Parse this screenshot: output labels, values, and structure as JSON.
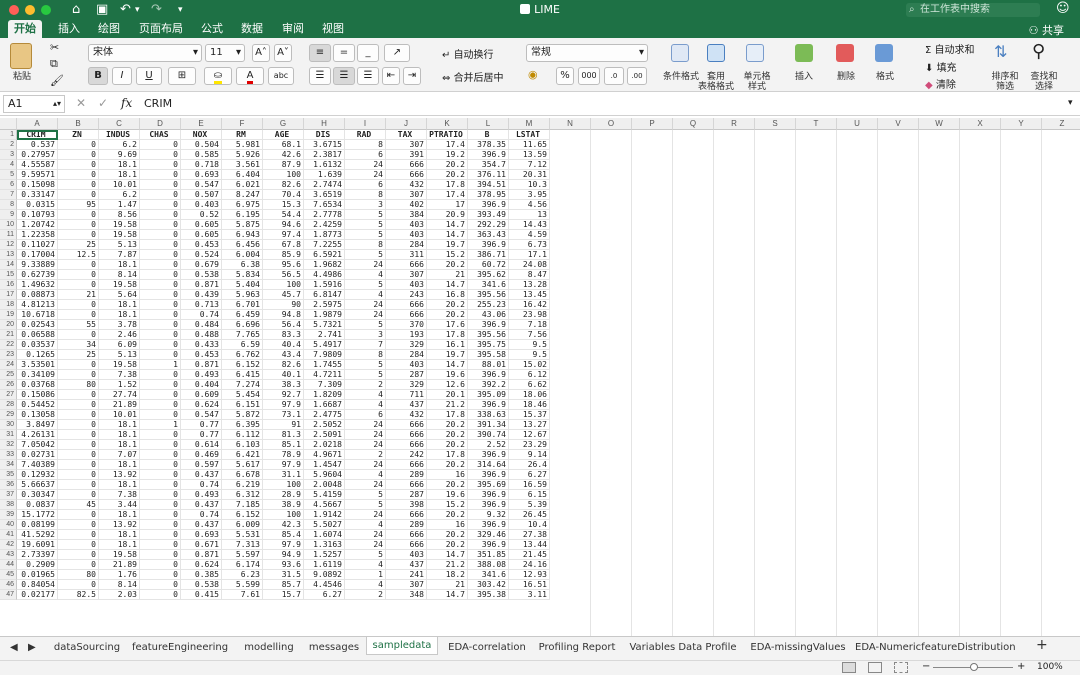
{
  "window": {
    "title": "LIME"
  },
  "search": {
    "placeholder": "在工作表中搜索"
  },
  "ribbon_tabs": [
    "开始",
    "插入",
    "绘图",
    "页面布局",
    "公式",
    "数据",
    "审阅",
    "视图"
  ],
  "share": {
    "label": "共享"
  },
  "home": {
    "paste": "粘贴",
    "font_name": "宋体",
    "font_size": "11",
    "wrap_text": "自动换行",
    "merge_center": "合并后居中",
    "number_format": "常规",
    "cond_format": "条件格式",
    "table_format": [
      "套用",
      "表格格式"
    ],
    "cell_style": [
      "单元格",
      "样式"
    ],
    "insert": "插入",
    "delete": "删除",
    "format": "格式",
    "autosum": "自动求和",
    "fill": "填充",
    "clear": "清除",
    "sort_filter": [
      "排序和",
      "筛选"
    ],
    "find_select": [
      "查找和",
      "选择"
    ]
  },
  "formula_bar": {
    "cell_ref": "A1",
    "fx": "fx",
    "content": "CRIM"
  },
  "columns": [
    "A",
    "B",
    "C",
    "D",
    "E",
    "F",
    "G",
    "H",
    "I",
    "J",
    "K",
    "L",
    "M",
    "N",
    "O",
    "P",
    "Q",
    "R",
    "S",
    "T",
    "U",
    "V",
    "W",
    "X",
    "Y",
    "Z"
  ],
  "table": {
    "headers": [
      "CRIM",
      "ZN",
      "INDUS",
      "CHAS",
      "NOX",
      "RM",
      "AGE",
      "DIS",
      "RAD",
      "TAX",
      "PTRATIO",
      "B",
      "LSTAT"
    ],
    "rows": [
      [
        "0.537",
        "0",
        "6.2",
        "0",
        "0.504",
        "5.981",
        "68.1",
        "3.6715",
        "8",
        "307",
        "17.4",
        "378.35",
        "11.65"
      ],
      [
        "0.27957",
        "0",
        "9.69",
        "0",
        "0.585",
        "5.926",
        "42.6",
        "2.3817",
        "6",
        "391",
        "19.2",
        "396.9",
        "13.59"
      ],
      [
        "4.55587",
        "0",
        "18.1",
        "0",
        "0.718",
        "3.561",
        "87.9",
        "1.6132",
        "24",
        "666",
        "20.2",
        "354.7",
        "7.12"
      ],
      [
        "9.59571",
        "0",
        "18.1",
        "0",
        "0.693",
        "6.404",
        "100",
        "1.639",
        "24",
        "666",
        "20.2",
        "376.11",
        "20.31"
      ],
      [
        "0.15098",
        "0",
        "10.01",
        "0",
        "0.547",
        "6.021",
        "82.6",
        "2.7474",
        "6",
        "432",
        "17.8",
        "394.51",
        "10.3"
      ],
      [
        "0.33147",
        "0",
        "6.2",
        "0",
        "0.507",
        "8.247",
        "70.4",
        "3.6519",
        "8",
        "307",
        "17.4",
        "378.95",
        "3.95"
      ],
      [
        "0.0315",
        "95",
        "1.47",
        "0",
        "0.403",
        "6.975",
        "15.3",
        "7.6534",
        "3",
        "402",
        "17",
        "396.9",
        "4.56"
      ],
      [
        "0.10793",
        "0",
        "8.56",
        "0",
        "0.52",
        "6.195",
        "54.4",
        "2.7778",
        "5",
        "384",
        "20.9",
        "393.49",
        "13"
      ],
      [
        "1.20742",
        "0",
        "19.58",
        "0",
        "0.605",
        "5.875",
        "94.6",
        "2.4259",
        "5",
        "403",
        "14.7",
        "292.29",
        "14.43"
      ],
      [
        "1.22358",
        "0",
        "19.58",
        "0",
        "0.605",
        "6.943",
        "97.4",
        "1.8773",
        "5",
        "403",
        "14.7",
        "363.43",
        "4.59"
      ],
      [
        "0.11027",
        "25",
        "5.13",
        "0",
        "0.453",
        "6.456",
        "67.8",
        "7.2255",
        "8",
        "284",
        "19.7",
        "396.9",
        "6.73"
      ],
      [
        "0.17004",
        "12.5",
        "7.87",
        "0",
        "0.524",
        "6.004",
        "85.9",
        "6.5921",
        "5",
        "311",
        "15.2",
        "386.71",
        "17.1"
      ],
      [
        "9.33889",
        "0",
        "18.1",
        "0",
        "0.679",
        "6.38",
        "95.6",
        "1.9682",
        "24",
        "666",
        "20.2",
        "60.72",
        "24.08"
      ],
      [
        "0.62739",
        "0",
        "8.14",
        "0",
        "0.538",
        "5.834",
        "56.5",
        "4.4986",
        "4",
        "307",
        "21",
        "395.62",
        "8.47"
      ],
      [
        "1.49632",
        "0",
        "19.58",
        "0",
        "0.871",
        "5.404",
        "100",
        "1.5916",
        "5",
        "403",
        "14.7",
        "341.6",
        "13.28"
      ],
      [
        "0.08873",
        "21",
        "5.64",
        "0",
        "0.439",
        "5.963",
        "45.7",
        "6.8147",
        "4",
        "243",
        "16.8",
        "395.56",
        "13.45"
      ],
      [
        "4.81213",
        "0",
        "18.1",
        "0",
        "0.713",
        "6.701",
        "90",
        "2.5975",
        "24",
        "666",
        "20.2",
        "255.23",
        "16.42"
      ],
      [
        "10.6718",
        "0",
        "18.1",
        "0",
        "0.74",
        "6.459",
        "94.8",
        "1.9879",
        "24",
        "666",
        "20.2",
        "43.06",
        "23.98"
      ],
      [
        "0.02543",
        "55",
        "3.78",
        "0",
        "0.484",
        "6.696",
        "56.4",
        "5.7321",
        "5",
        "370",
        "17.6",
        "396.9",
        "7.18"
      ],
      [
        "0.06588",
        "0",
        "2.46",
        "0",
        "0.488",
        "7.765",
        "83.3",
        "2.741",
        "3",
        "193",
        "17.8",
        "395.56",
        "7.56"
      ],
      [
        "0.03537",
        "34",
        "6.09",
        "0",
        "0.433",
        "6.59",
        "40.4",
        "5.4917",
        "7",
        "329",
        "16.1",
        "395.75",
        "9.5"
      ],
      [
        "0.1265",
        "25",
        "5.13",
        "0",
        "0.453",
        "6.762",
        "43.4",
        "7.9809",
        "8",
        "284",
        "19.7",
        "395.58",
        "9.5"
      ],
      [
        "3.53501",
        "0",
        "19.58",
        "1",
        "0.871",
        "6.152",
        "82.6",
        "1.7455",
        "5",
        "403",
        "14.7",
        "88.01",
        "15.02"
      ],
      [
        "0.34109",
        "0",
        "7.38",
        "0",
        "0.493",
        "6.415",
        "40.1",
        "4.7211",
        "5",
        "287",
        "19.6",
        "396.9",
        "6.12"
      ],
      [
        "0.03768",
        "80",
        "1.52",
        "0",
        "0.404",
        "7.274",
        "38.3",
        "7.309",
        "2",
        "329",
        "12.6",
        "392.2",
        "6.62"
      ],
      [
        "0.15086",
        "0",
        "27.74",
        "0",
        "0.609",
        "5.454",
        "92.7",
        "1.8209",
        "4",
        "711",
        "20.1",
        "395.09",
        "18.06"
      ],
      [
        "0.54452",
        "0",
        "21.89",
        "0",
        "0.624",
        "6.151",
        "97.9",
        "1.6687",
        "4",
        "437",
        "21.2",
        "396.9",
        "18.46"
      ],
      [
        "0.13058",
        "0",
        "10.01",
        "0",
        "0.547",
        "5.872",
        "73.1",
        "2.4775",
        "6",
        "432",
        "17.8",
        "338.63",
        "15.37"
      ],
      [
        "3.8497",
        "0",
        "18.1",
        "1",
        "0.77",
        "6.395",
        "91",
        "2.5052",
        "24",
        "666",
        "20.2",
        "391.34",
        "13.27"
      ],
      [
        "4.26131",
        "0",
        "18.1",
        "0",
        "0.77",
        "6.112",
        "81.3",
        "2.5091",
        "24",
        "666",
        "20.2",
        "390.74",
        "12.67"
      ],
      [
        "7.05042",
        "0",
        "18.1",
        "0",
        "0.614",
        "6.103",
        "85.1",
        "2.0218",
        "24",
        "666",
        "20.2",
        "2.52",
        "23.29"
      ],
      [
        "0.02731",
        "0",
        "7.07",
        "0",
        "0.469",
        "6.421",
        "78.9",
        "4.9671",
        "2",
        "242",
        "17.8",
        "396.9",
        "9.14"
      ],
      [
        "7.40389",
        "0",
        "18.1",
        "0",
        "0.597",
        "5.617",
        "97.9",
        "1.4547",
        "24",
        "666",
        "20.2",
        "314.64",
        "26.4"
      ],
      [
        "0.12932",
        "0",
        "13.92",
        "0",
        "0.437",
        "6.678",
        "31.1",
        "5.9604",
        "4",
        "289",
        "16",
        "396.9",
        "6.27"
      ],
      [
        "5.66637",
        "0",
        "18.1",
        "0",
        "0.74",
        "6.219",
        "100",
        "2.0048",
        "24",
        "666",
        "20.2",
        "395.69",
        "16.59"
      ],
      [
        "0.30347",
        "0",
        "7.38",
        "0",
        "0.493",
        "6.312",
        "28.9",
        "5.4159",
        "5",
        "287",
        "19.6",
        "396.9",
        "6.15"
      ],
      [
        "0.0837",
        "45",
        "3.44",
        "0",
        "0.437",
        "7.185",
        "38.9",
        "4.5667",
        "5",
        "398",
        "15.2",
        "396.9",
        "5.39"
      ],
      [
        "15.1772",
        "0",
        "18.1",
        "0",
        "0.74",
        "6.152",
        "100",
        "1.9142",
        "24",
        "666",
        "20.2",
        "9.32",
        "26.45"
      ],
      [
        "0.08199",
        "0",
        "13.92",
        "0",
        "0.437",
        "6.009",
        "42.3",
        "5.5027",
        "4",
        "289",
        "16",
        "396.9",
        "10.4"
      ],
      [
        "41.5292",
        "0",
        "18.1",
        "0",
        "0.693",
        "5.531",
        "85.4",
        "1.6074",
        "24",
        "666",
        "20.2",
        "329.46",
        "27.38"
      ],
      [
        "19.6091",
        "0",
        "18.1",
        "0",
        "0.671",
        "7.313",
        "97.9",
        "1.3163",
        "24",
        "666",
        "20.2",
        "396.9",
        "13.44"
      ],
      [
        "2.73397",
        "0",
        "19.58",
        "0",
        "0.871",
        "5.597",
        "94.9",
        "1.5257",
        "5",
        "403",
        "14.7",
        "351.85",
        "21.45"
      ],
      [
        "0.2909",
        "0",
        "21.89",
        "0",
        "0.624",
        "6.174",
        "93.6",
        "1.6119",
        "4",
        "437",
        "21.2",
        "388.08",
        "24.16"
      ],
      [
        "0.01965",
        "80",
        "1.76",
        "0",
        "0.385",
        "6.23",
        "31.5",
        "9.0892",
        "1",
        "241",
        "18.2",
        "341.6",
        "12.93"
      ],
      [
        "0.84054",
        "0",
        "8.14",
        "0",
        "0.538",
        "5.599",
        "85.7",
        "4.4546",
        "4",
        "307",
        "21",
        "303.42",
        "16.51"
      ],
      [
        "0.02177",
        "82.5",
        "2.03",
        "0",
        "0.415",
        "7.61",
        "15.7",
        "6.27",
        "2",
        "348",
        "14.7",
        "395.38",
        "3.11"
      ]
    ]
  },
  "sheets": [
    "dataSourcing",
    "featureEngineering",
    "modelling",
    "messages",
    "sampledata",
    "EDA-correlation",
    "Profiling Report",
    "Variables Data Profile",
    "EDA-missingValues",
    "EDA-NumericfeatureDistribution"
  ],
  "active_sheet": "sampledata",
  "add_sheet": "+",
  "zoom": "100%",
  "colors": {
    "brand": "#1e7145",
    "ribbon": "#f3f3f3",
    "header_bg": "#efefef"
  }
}
